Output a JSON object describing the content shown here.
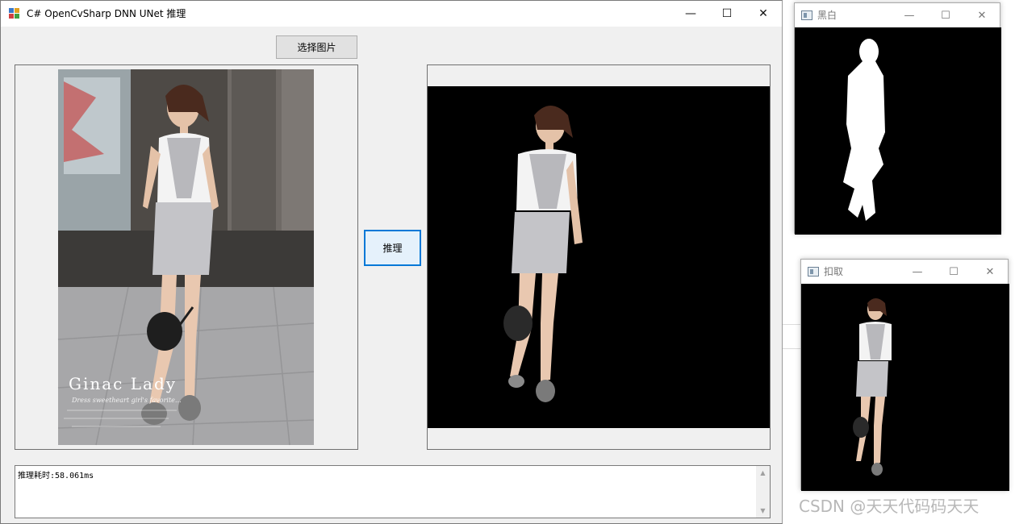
{
  "window": {
    "title": "C# OpenCvSharp DNN UNet 推理",
    "minimize": "—",
    "maximize": "☐",
    "close": "✕"
  },
  "buttons": {
    "select_image": "选择图片",
    "infer": "推理"
  },
  "output": {
    "text": "推理耗时:58.061ms",
    "scroll_up": "▲",
    "scroll_down": "▼"
  },
  "popup_bw": {
    "title": "黑白",
    "minimize": "—",
    "maximize": "☐",
    "close": "✕"
  },
  "popup_cut": {
    "title": "扣取",
    "minimize": "—",
    "maximize": "☐",
    "close": "✕"
  },
  "photo_overlay": {
    "brand": "Ginac Lady",
    "tagline": "Dress sweetheart girl's favorite…"
  },
  "watermark": "CSDN @天天代码码天天",
  "colors": {
    "accent": "#0078d7",
    "window_bg": "#f0f0f0",
    "image_bg": "#000000"
  }
}
